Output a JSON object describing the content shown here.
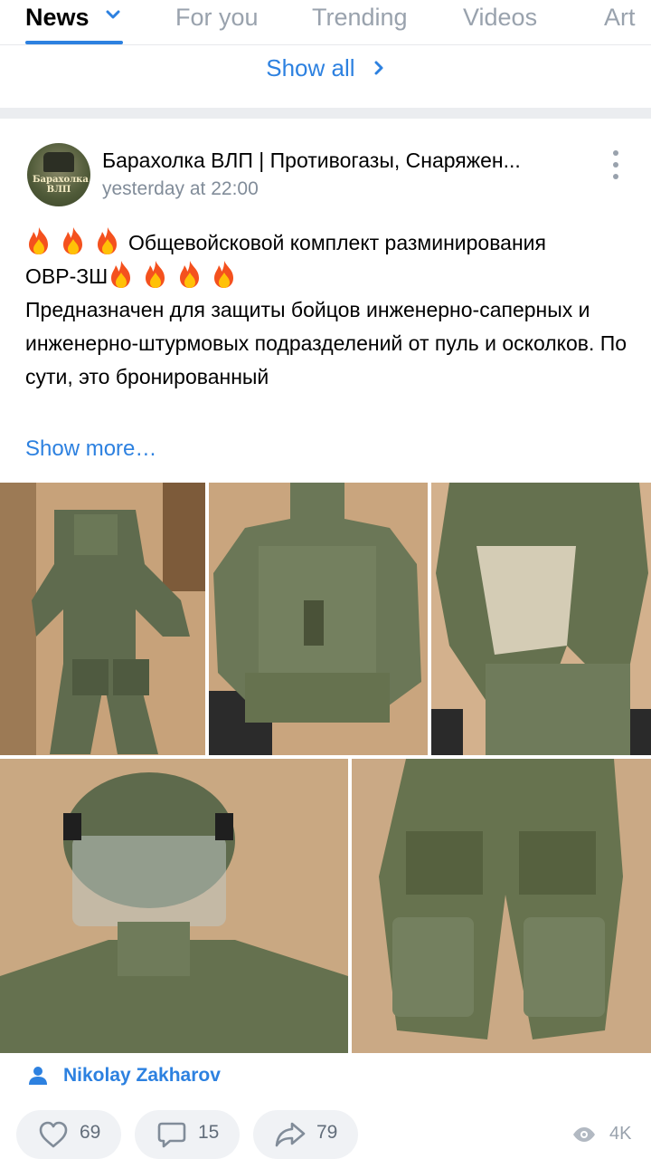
{
  "tabs": [
    {
      "label": "News",
      "active": true
    },
    {
      "label": "For you"
    },
    {
      "label": "Trending"
    },
    {
      "label": "Videos"
    },
    {
      "label": "Art"
    }
  ],
  "show_all_label": "Show all",
  "post": {
    "avatar_text": "Барахолка ВЛП",
    "group_name": "Барахолка ВЛП | Противогазы, Снаряжен...",
    "time": "yesterday at 22:00",
    "title_line1": "Общевойсковой комплект разминирования",
    "title_line2": "ОВР-ЗШ",
    "body": "Предназначен для защиты бойцов инженерно-саперных и инженерно-штурмовых подразделений от пуль и осколков. По сути, это бронированный",
    "show_more_label": "Show more…",
    "author": "Nikolay Zakharov",
    "likes": "69",
    "comments": "15",
    "shares": "79",
    "views": "4K"
  },
  "icons": {
    "tab_dropdown": "chevron-down-icon",
    "show_all": "chevron-right-icon",
    "menu": "more-vertical-icon",
    "title_emoji": "fire-emoji-icon",
    "author": "person-icon",
    "like": "heart-icon",
    "comment": "comment-icon",
    "share": "share-arrow-icon",
    "views": "eye-icon"
  },
  "colors": {
    "accent": "#2d81e0",
    "secondary_text": "#818c99",
    "action_bg": "#f0f2f5",
    "separator": "#ebedf0"
  }
}
